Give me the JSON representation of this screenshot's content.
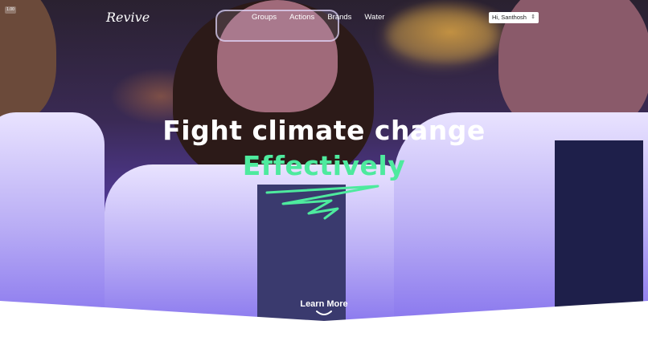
{
  "brand": {
    "logo": "Revive",
    "badge": "1.00"
  },
  "nav": {
    "links": [
      {
        "label": "Groups"
      },
      {
        "label": "Actions"
      },
      {
        "label": "Brands"
      },
      {
        "label": "Water"
      }
    ]
  },
  "user": {
    "selected": "Hi, Santhosh"
  },
  "hero": {
    "headline": "Fight climate change",
    "subline": "Effectively",
    "accent_color": "#4eea9e",
    "cta": "Learn More"
  },
  "icons": [
    "squiggle-underline-icon",
    "chevron-down-icon",
    "select-arrows-icon"
  ]
}
